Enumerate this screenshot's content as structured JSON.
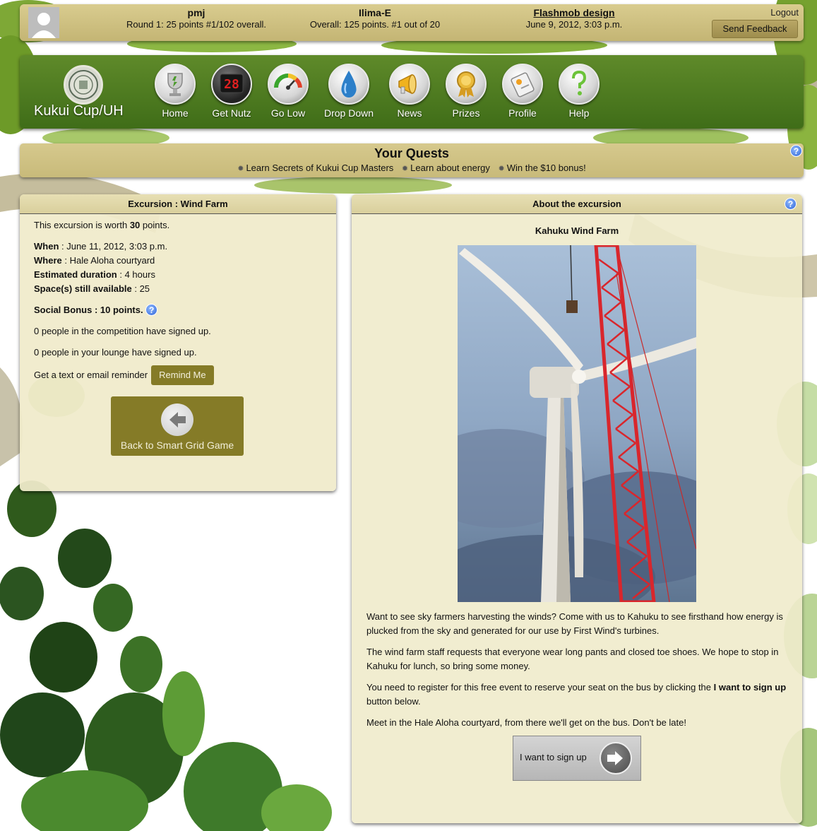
{
  "user": {
    "name": "pmj",
    "round_status": "Round 1: 25 points #1/102 overall."
  },
  "team": {
    "name": "Ilima-E",
    "status": "Overall: 125 points. #1 out of 20"
  },
  "event": {
    "name": "Flashmob design",
    "datetime": "June 9, 2012, 3:03 p.m."
  },
  "header_actions": {
    "logout": "Logout",
    "feedback": "Send Feedback"
  },
  "brand": {
    "name": "Kukui Cup/UH"
  },
  "nav": {
    "items": [
      {
        "label": "Home",
        "icon": "trophy-icon"
      },
      {
        "label": "Get Nutz",
        "icon": "scoreboard-icon",
        "counter": "28"
      },
      {
        "label": "Go Low",
        "icon": "gauge-icon"
      },
      {
        "label": "Drop Down",
        "icon": "water-drop-icon"
      },
      {
        "label": "News",
        "icon": "megaphone-icon"
      },
      {
        "label": "Prizes",
        "icon": "medal-icon"
      },
      {
        "label": "Profile",
        "icon": "id-tag-icon"
      },
      {
        "label": "Help",
        "icon": "question-icon"
      }
    ]
  },
  "quests": {
    "title": "Your Quests",
    "items": [
      "Learn Secrets of Kukui Cup Masters",
      "Learn about energy",
      "Win the $10 bonus!"
    ],
    "help": "?"
  },
  "excursion": {
    "header": "Excursion : Wind Farm",
    "worth_prefix": "This excursion is worth ",
    "worth_points": "30",
    "worth_suffix": " points.",
    "when_label": "When",
    "when_value": " : June 11, 2012, 3:03 p.m.",
    "where_label": "Where",
    "where_value": " : Hale Aloha courtyard",
    "duration_label": "Estimated duration",
    "duration_value": " : 4 hours",
    "spaces_label": "Space(s) still available",
    "spaces_value": " : 25",
    "social_bonus": "Social Bonus : 10 points.",
    "competition_signups": "0 people in the competition have signed up.",
    "lounge_signups": "0 people in your lounge have signed up.",
    "reminder_text": "Get a text or email reminder",
    "remind_button": "Remind Me",
    "back_button": "Back to Smart Grid Game"
  },
  "about": {
    "header": "About the excursion",
    "title": "Kahuku Wind Farm",
    "paragraph1": "Want to see sky farmers harvesting the winds? Come with us to Kahuku to see firsthand how energy is plucked from the sky and generated for our use by First Wind's turbines.",
    "paragraph2": "The wind farm staff requests that everyone wear long pants and closed toe shoes. We hope to stop in Kahuku for lunch, so bring some money.",
    "paragraph3_start": "You need to register for this free event to reserve your seat on the bus by clicking the ",
    "paragraph3_bold": "I want to sign up",
    "paragraph3_end": " button below.",
    "paragraph4": "Meet in the Hale Aloha courtyard, from there we'll get on the bus. Don't be late!",
    "signup_button": "I want to sign up"
  },
  "colors": {
    "nav_green": "#4f7c22",
    "tan_bar": "#d2c487",
    "button_olive": "#857b27",
    "panel_bg": "#f0ebcb",
    "help_blue": "#2f65d6"
  }
}
